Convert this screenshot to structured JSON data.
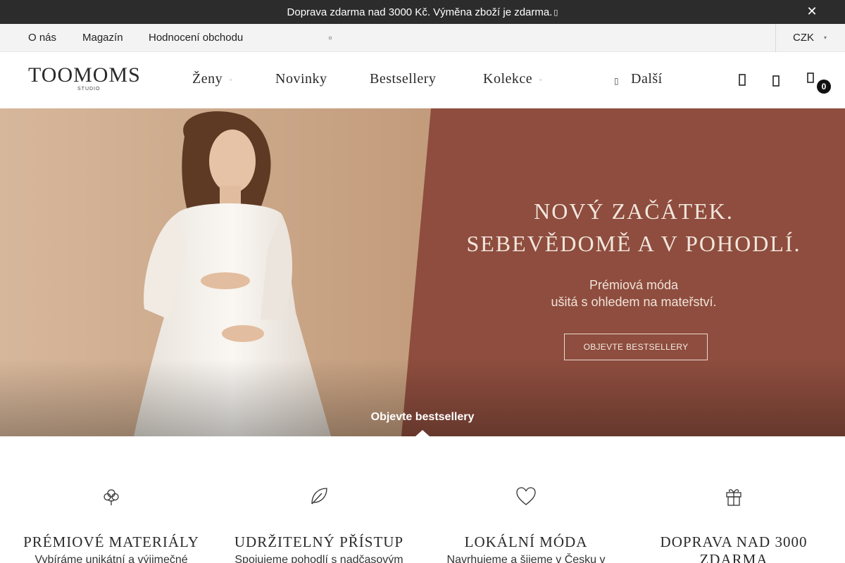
{
  "announcement": {
    "text": "Doprava zdarma nad 3000 Kč. Výměna zboží je zdarma. ",
    "close_label": "✕"
  },
  "toplinks": {
    "items": [
      "O nás",
      "Magazín",
      "Hodnocení obchodu"
    ],
    "currency": "CZK"
  },
  "header": {
    "logo_word": "TOOMOMS",
    "logo_sub": "STUDIO",
    "nav": [
      "Ženy",
      "Novinky",
      "Bestsellery",
      "Kolekce",
      "Další"
    ],
    "cart_count": "0"
  },
  "hero": {
    "heading_line1": "NOVÝ ZAČÁTEK.",
    "heading_line2": "SEBEVĚDOMĚ A V POHODLÍ.",
    "sub_line1": "Prémiová móda",
    "sub_line2": "ušitá s ohledem na mateřství.",
    "button": "OBJEVTE BESTSELLERY",
    "tab_label": "Objevte bestsellery",
    "colors": {
      "panel": "#8e4d3e",
      "beige": "#c8a585"
    }
  },
  "features": [
    {
      "icon": "cotton-icon",
      "title_line1": "PRÉMIOVÉ MATERIÁLY",
      "title_line2": "",
      "text": "Vybíráme unikátní a výjimečné"
    },
    {
      "icon": "leaf-icon",
      "title_line1": "UDRŽITELNÝ PŘÍSTUP",
      "title_line2": "",
      "text": "Spojujeme pohodlí s nadčasovým"
    },
    {
      "icon": "heart-icon",
      "title_line1": "LOKÁLNÍ MÓDA",
      "title_line2": "",
      "text": "Navrhujeme a šijeme v Česku v"
    },
    {
      "icon": "gift-icon",
      "title_line1": "DOPRAVA NAD 3000",
      "title_line2": "ZDARMA",
      "text": ""
    }
  ]
}
